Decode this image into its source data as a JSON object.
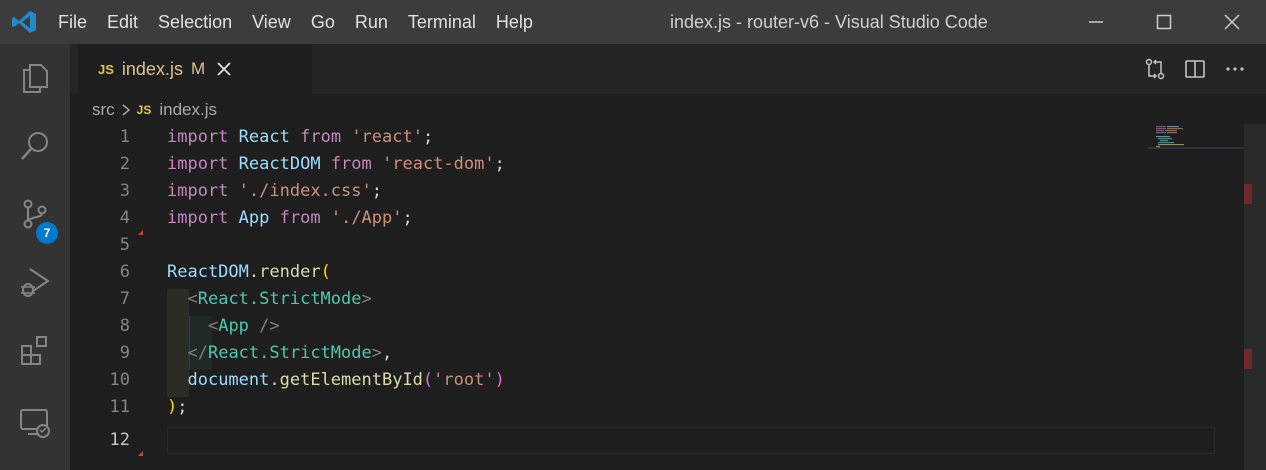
{
  "window": {
    "title": "index.js - router-v6 - Visual Studio Code",
    "menu": [
      "File",
      "Edit",
      "Selection",
      "View",
      "Go",
      "Run",
      "Terminal",
      "Help"
    ]
  },
  "activity_bar": {
    "items": [
      "explorer-icon",
      "search-icon",
      "source-control-icon",
      "run-debug-icon",
      "extensions-icon",
      "remote-explorer-icon"
    ],
    "source_control_badge": "7"
  },
  "tab": {
    "icon_label": "JS",
    "name": "index.js",
    "modified_marker": "M"
  },
  "breadcrumb": {
    "folder": "src",
    "file_icon": "JS",
    "file": "index.js"
  },
  "editor": {
    "current_line": "12",
    "line_numbers": [
      "1",
      "2",
      "3",
      "4",
      "5",
      "6",
      "7",
      "8",
      "9",
      "10",
      "11",
      "12"
    ]
  },
  "colors": {
    "title_bar": "#3c3c3c",
    "activity_bar": "#333333",
    "editor_bg": "#1e1e1e",
    "badge": "#007acc",
    "keyword": "#c586c0",
    "string": "#ce9178",
    "variable": "#9cdcfe"
  }
}
